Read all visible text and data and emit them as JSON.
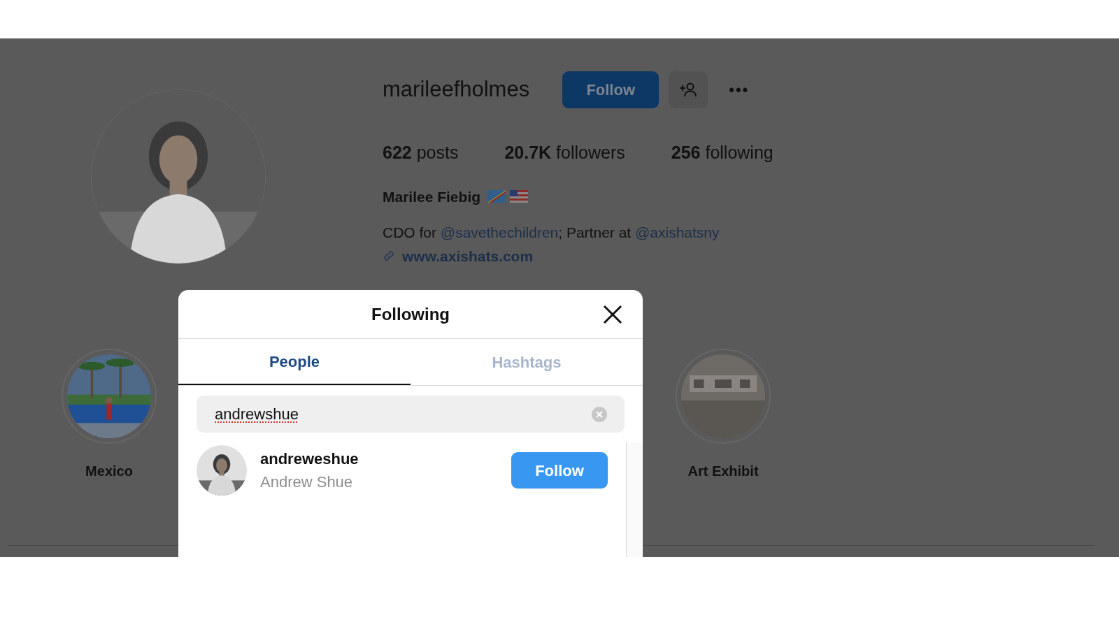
{
  "profile": {
    "username": "marileefholmes",
    "follow_button": "Follow",
    "menu_dots": "•••",
    "stats": [
      {
        "count": "622",
        "label": "posts"
      },
      {
        "count": "20.7K",
        "label": "followers"
      },
      {
        "count": "256",
        "label": "following"
      }
    ],
    "full_name": "Marilee Fiebig",
    "bio": [
      {
        "kind": "text",
        "text": "CDO for "
      },
      {
        "kind": "mention",
        "text": "@savethechildren"
      },
      {
        "kind": "text",
        "text": "; Partner at "
      },
      {
        "kind": "mention",
        "text": "@axishatsny"
      }
    ],
    "website": "www.axishats.com"
  },
  "highlights": [
    {
      "label": "Mexico",
      "kind": "beach"
    },
    {
      "label": "Art Exhibit",
      "kind": "gallery"
    }
  ],
  "modal": {
    "title": "Following",
    "tabs": [
      {
        "label": "People",
        "selected": true
      },
      {
        "label": "Hashtags",
        "selected": false
      }
    ],
    "search": {
      "value": "andrewshue"
    },
    "results": [
      {
        "username": "andreweshue",
        "name": "Andrew Shue",
        "button": "Follow"
      }
    ]
  }
}
